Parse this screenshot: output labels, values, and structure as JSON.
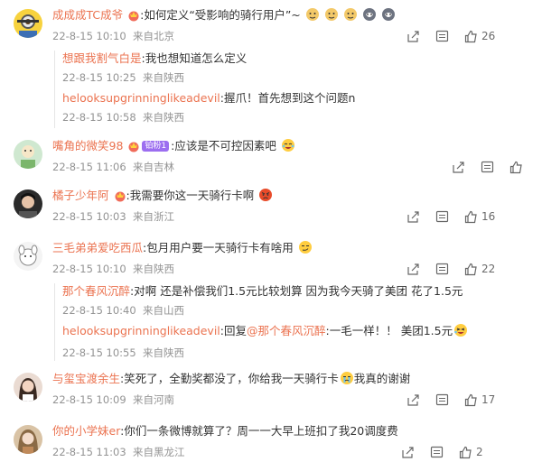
{
  "colors": {
    "username": "#eb7350",
    "meta": "#939393",
    "text": "#333333"
  },
  "comments": [
    {
      "username": "成成成TC成爷",
      "text": ":如何定义“受影响的骑行用户”~",
      "time": "22-8-15 10:10",
      "location": "来自北京",
      "likes": "26",
      "emojis": [
        "doge-icon",
        "doge-icon",
        "doge-icon",
        "doge-icon",
        "doge-icon"
      ],
      "replies": [
        {
          "username": "想跟我割气白是",
          "text": ":我也想知道怎么定义",
          "time": "22-8-15 10:25",
          "location": "来自陕西"
        },
        {
          "username": "helooksupgrinninglikeadevil",
          "text": ":握爪！首先想到这个问题n",
          "time": "22-8-15 10:58",
          "location": "来自陕西"
        }
      ]
    },
    {
      "username": "嘴角的微笑98",
      "badge": "铂粉1",
      "text": ":应该是不可控因素吧",
      "time": "22-8-15 11:06",
      "location": "来自吉林",
      "likes": ""
    },
    {
      "username": "橘子少年阿",
      "text": ":我需要你这一天骑行卡啊",
      "time": "22-8-15 10:03",
      "location": "来自浙江",
      "likes": "16"
    },
    {
      "username": "三毛弟弟爱吃西瓜",
      "text": ":包月用户要一天骑行卡有啥用",
      "time": "22-8-15 10:10",
      "location": "来自陕西",
      "likes": "22",
      "replies": [
        {
          "username": "那个春风沉醉",
          "text": ":对啊 还是补偿我们1.5元比较划算 因为我今天骑了美团 花了1.5元",
          "time": "22-8-15 10:40",
          "location": "来自山西"
        },
        {
          "username": "helooksupgrinninglikeadevil",
          "text_prefix": ":回复",
          "mention": "@那个春风沉醉",
          "text": ":一毛一样！！ 美团1.5元",
          "time": "22-8-15 10:55",
          "location": "来自陕西"
        }
      ]
    },
    {
      "username": "与玺宝渡余生",
      "text": ":笑死了，全勤奖都没了，你给我一天骑行卡",
      "text_suffix": "我真的谢谢",
      "time": "22-8-15 10:09",
      "location": "来自河南",
      "likes": "17"
    },
    {
      "username": "你的小学妹er",
      "text": ":你们一条微博就算了？周一一大早上班扣了我20调度费",
      "time": "22-8-15 11:03",
      "location": "来自黑龙江",
      "likes": "2"
    }
  ]
}
